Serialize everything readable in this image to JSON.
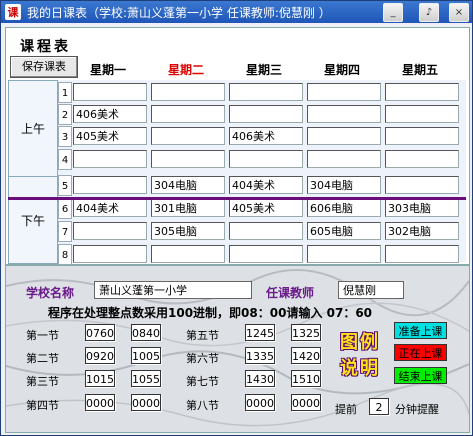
{
  "window": {
    "title": "我的日课表（学校:萧山义蓬第一小学  任课教师:倪慧刚 ）",
    "minimize_symbol": "_",
    "music_symbol": "♪",
    "close_symbol": "×",
    "app_icon_glyph": "课"
  },
  "schedule": {
    "title": "课程表",
    "save_label": "保存课表",
    "days": [
      "星期一",
      "星期二",
      "星期三",
      "星期四",
      "星期五"
    ],
    "today_color": "#e00000",
    "morning_label": "上午",
    "afternoon_label": "下午",
    "row_numbers": [
      "1",
      "2",
      "3",
      "4",
      "5",
      "6",
      "7",
      "8"
    ],
    "cells": [
      [
        "",
        "",
        "",
        "",
        ""
      ],
      [
        "406美术",
        "",
        "",
        "",
        ""
      ],
      [
        "405美术",
        "",
        "406美术",
        "",
        ""
      ],
      [
        "",
        "",
        "",
        "",
        ""
      ],
      [
        "",
        "304电脑",
        "404美术",
        "304电脑",
        ""
      ],
      [
        "404美术",
        "301电脑",
        "405美术",
        "606电脑",
        "303电脑"
      ],
      [
        "",
        "305电脑",
        "",
        "605电脑",
        "302电脑"
      ],
      [
        "",
        "",
        "",
        "",
        ""
      ]
    ]
  },
  "settings": {
    "school_label": "学校名称",
    "school_value": "萧山义蓬第一小学",
    "teacher_label": "任课教师",
    "teacher_value": "倪慧刚",
    "note": "程序在处理整点数采用100进制，即08：00请输入 07：60",
    "periods": [
      {
        "label": "第一节",
        "start": "0760",
        "end": "0840"
      },
      {
        "label": "第二节",
        "start": "0920",
        "end": "1005"
      },
      {
        "label": "第三节",
        "start": "1015",
        "end": "1055"
      },
      {
        "label": "第四节",
        "start": "0000",
        "end": "0000"
      },
      {
        "label": "第五节",
        "start": "1245",
        "end": "1325"
      },
      {
        "label": "第六节",
        "start": "1335",
        "end": "1420"
      },
      {
        "label": "第七节",
        "start": "1430",
        "end": "1510"
      },
      {
        "label": "第八节",
        "start": "0000",
        "end": "0000"
      }
    ],
    "legend_title_1": "图例",
    "legend_title_2": "说明",
    "legend": [
      {
        "label": "准备上课",
        "color": "#00e0e0",
        "text_color": "#000000"
      },
      {
        "label": "正在上课",
        "color": "#ff0000",
        "text_color": "#000000"
      },
      {
        "label": "结束上课",
        "color": "#00ee00",
        "text_color": "#000000"
      }
    ],
    "remind_prefix": "提前",
    "remind_minutes": "2",
    "remind_suffix": "分钟提醒"
  }
}
